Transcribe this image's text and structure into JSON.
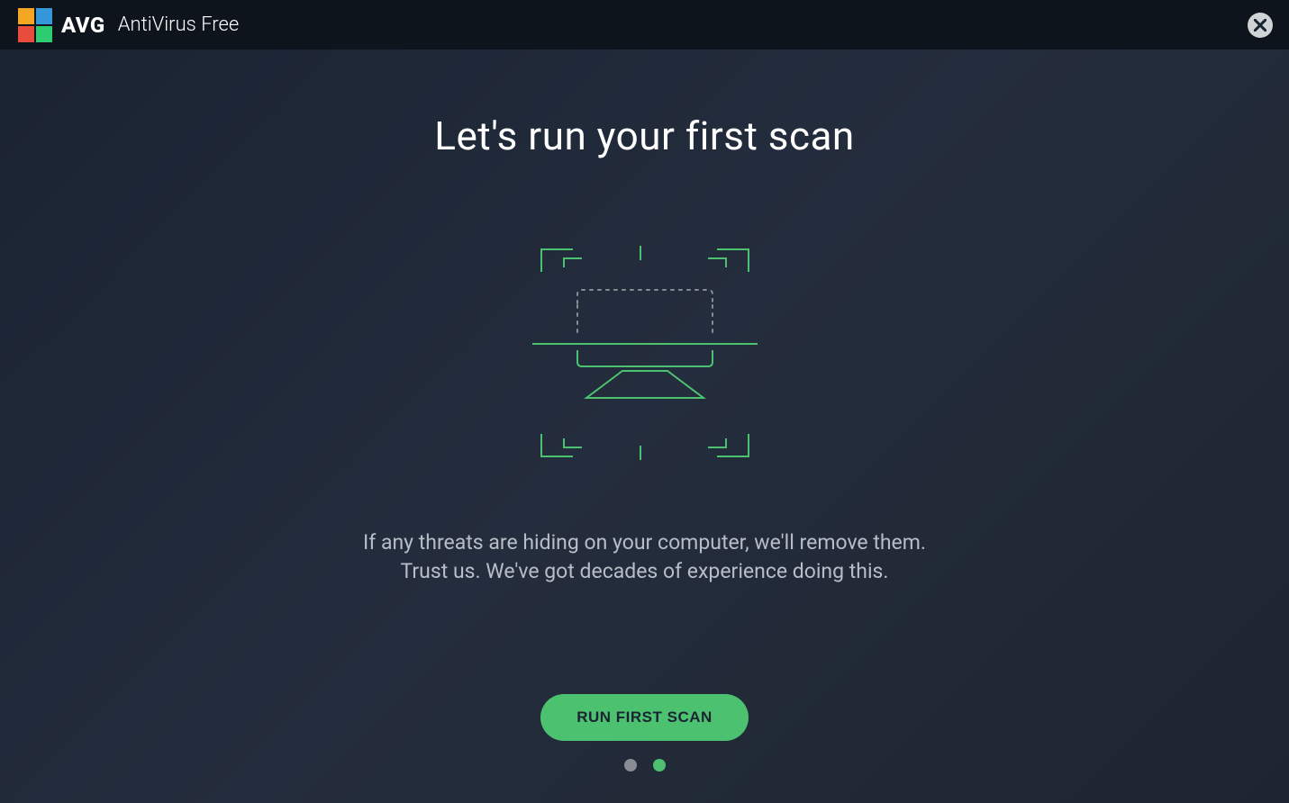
{
  "titlebar": {
    "brand": "AVG",
    "product": "AntiVirus Free"
  },
  "main": {
    "heading": "Let's run your first scan",
    "description_line1": "If any threats are hiding on your computer, we'll remove them.",
    "description_line2": "Trust us. We've got decades of experience doing this.",
    "cta_label": "RUN FIRST SCAN"
  },
  "pagination": {
    "total": 2,
    "active_index": 1
  },
  "icons": {
    "close": "close-icon",
    "scan_illustration": "computer-scan-icon"
  },
  "colors": {
    "accent": "#4cc271",
    "background_dark": "#1a2332",
    "titlebar": "#0e141c",
    "text_primary": "#ffffff",
    "text_secondary": "#b8bec7"
  }
}
